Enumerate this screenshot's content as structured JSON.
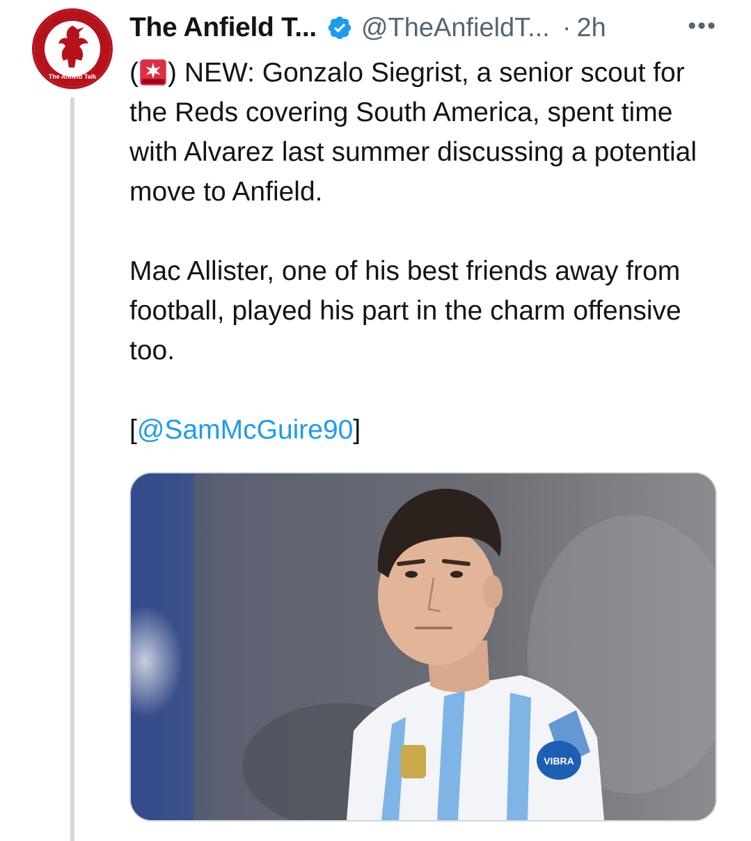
{
  "tweet": {
    "display_name": "The Anfield T...",
    "handle": "@TheAnfieldT...",
    "separator": "·",
    "time": "2h",
    "more_label": "•••",
    "text": {
      "line1_open": "(",
      "line1_rest": ") NEW: Gonzalo Siegrist, a senior scout for the Reds covering South America, spent time with Alvarez last summer discussing a potential move to Anfield.",
      "paragraph2": "Mac Allister, one of his best friends away from football, played his part in the charm offensive too.",
      "bracket_open": "[",
      "mention": "@SamMcGuire90",
      "bracket_close": "]"
    },
    "avatar": {
      "brand_text": "The Anfield Talk",
      "color": "#b5121b"
    },
    "media": {
      "jersey_badge_text": "VIBRA"
    }
  },
  "colors": {
    "verified": "#1d9bf0",
    "link": "#1d9bf0",
    "secondary_text": "#536471",
    "thread_line": "#cfd9de"
  },
  "icons": {
    "verified": "verified-badge-icon",
    "emoji": "rotating-light-emoji",
    "more": "more-options-icon"
  }
}
